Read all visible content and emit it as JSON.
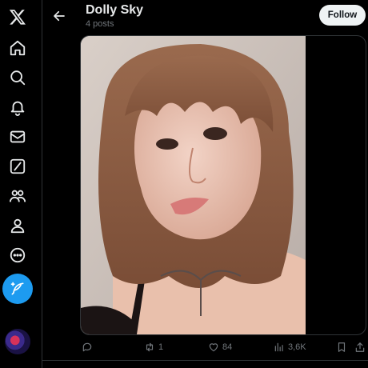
{
  "profile": {
    "name": "Dolly Sky",
    "posts_count": "4 posts",
    "follow_label": "Follow"
  },
  "sidebar": {
    "items": [
      {
        "icon": "x-logo-icon"
      },
      {
        "icon": "home-icon"
      },
      {
        "icon": "search-icon"
      },
      {
        "icon": "notifications-bell-icon"
      },
      {
        "icon": "messages-envelope-icon"
      },
      {
        "icon": "grok-icon"
      },
      {
        "icon": "communities-icon"
      },
      {
        "icon": "profile-icon"
      },
      {
        "icon": "more-icon"
      }
    ],
    "compose_icon": "compose-feather-icon"
  },
  "post": {
    "media_description": "photo",
    "actions": {
      "replies": "",
      "reposts": "1",
      "likes": "84",
      "views": "3,6K"
    }
  },
  "colors": {
    "background": "#000000",
    "accent": "#1d9bf0",
    "text": "#e7e9ea",
    "muted": "#71767b",
    "border": "#2f3336"
  }
}
